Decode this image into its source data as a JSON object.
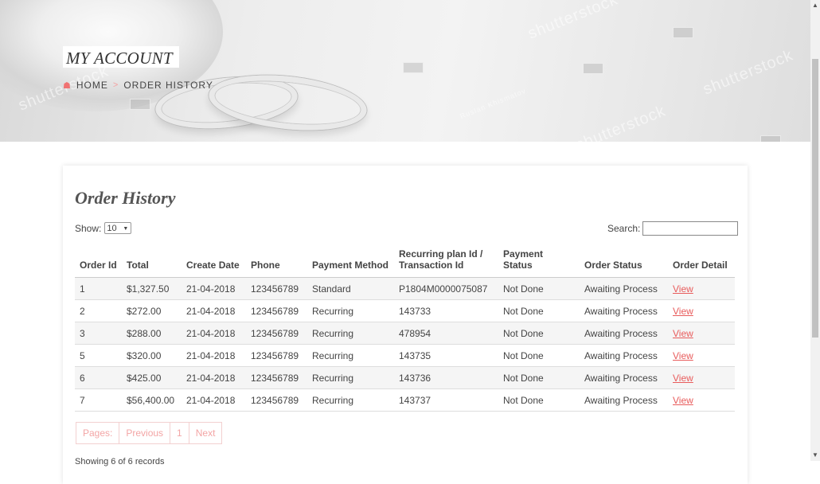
{
  "header": {
    "title": "MY ACCOUNT",
    "breadcrumb": {
      "home": "HOME",
      "separator": ">",
      "current": "ORDER HISTORY"
    },
    "watermarks": [
      "shutterstock",
      "shutterstock",
      "Ruslan Khismatov",
      "shutterstock",
      "shutterstock"
    ]
  },
  "main": {
    "heading": "Order History",
    "show_label": "Show:",
    "show_value": "10",
    "search_label": "Search:",
    "search_value": "",
    "columns": [
      "Order Id",
      "Total",
      "Create Date",
      "Phone",
      "Payment Method",
      "Recurring plan Id / Transaction Id",
      "Payment Status",
      "Order Status",
      "Order Detail"
    ],
    "rows": [
      [
        "1",
        "$1,327.50",
        "21-04-2018",
        "123456789",
        "Standard",
        "P1804M0000075087",
        "Not Done",
        "Awaiting Process",
        "View"
      ],
      [
        "2",
        "$272.00",
        "21-04-2018",
        "123456789",
        "Recurring",
        "143733",
        "Not Done",
        "Awaiting Process",
        "View"
      ],
      [
        "3",
        "$288.00",
        "21-04-2018",
        "123456789",
        "Recurring",
        "478954",
        "Not Done",
        "Awaiting Process",
        "View"
      ],
      [
        "5",
        "$320.00",
        "21-04-2018",
        "123456789",
        "Recurring",
        "143735",
        "Not Done",
        "Awaiting Process",
        "View"
      ],
      [
        "6",
        "$425.00",
        "21-04-2018",
        "123456789",
        "Recurring",
        "143736",
        "Not Done",
        "Awaiting Process",
        "View"
      ],
      [
        "7",
        "$56,400.00",
        "21-04-2018",
        "123456789",
        "Recurring",
        "143737",
        "Not Done",
        "Awaiting Process",
        "View"
      ]
    ],
    "pagination": {
      "pages_label": "Pages:",
      "previous": "Previous",
      "page": "1",
      "next": "Next"
    },
    "showing": "Showing 6 of 6 records"
  },
  "colors": {
    "accent": "#e85c5c",
    "pager": "#f3a5a5"
  },
  "icons": {
    "home": "home-icon",
    "separator": "chevron-right-icon"
  }
}
